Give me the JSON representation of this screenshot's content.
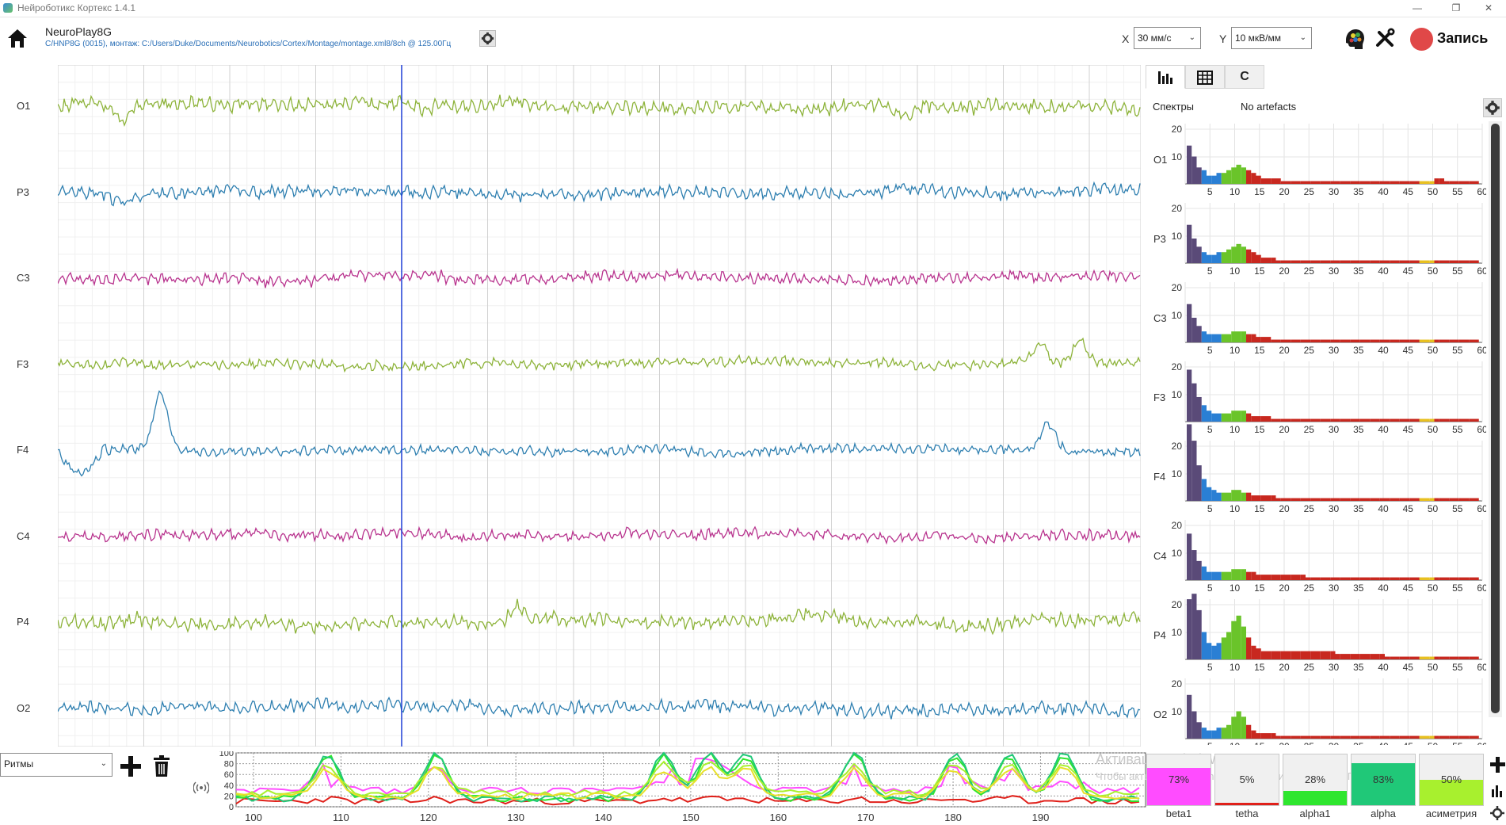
{
  "window": {
    "title": "Нейроботикс Кортекс 1.4.1",
    "minimize": "—",
    "restore": "❐",
    "close": "✕"
  },
  "header": {
    "device_name": "NeuroPlay8G",
    "device_path": "C/HNP8G (0015), монтаж: C:/Users/Duke/Documents/Neurobotics/Cortex/Montage/montage.xml8/8ch @ 125.00Гц",
    "x_label": "X",
    "x_value": "30 мм/с",
    "y_label": "Y",
    "y_value": "10 мкВ/мм",
    "record_label": "Запись"
  },
  "eeg": {
    "channels": [
      {
        "name": "O1",
        "color": "#8db33a",
        "amp": 9,
        "spikes": [
          [
            80,
            22
          ],
          [
            1070,
            14
          ]
        ]
      },
      {
        "name": "P3",
        "color": "#2e7fb0",
        "amp": 8,
        "spikes": [
          [
            80,
            10
          ]
        ]
      },
      {
        "name": "C3",
        "color": "#b8338e",
        "amp": 7,
        "spikes": []
      },
      {
        "name": "F3",
        "color": "#8db33a",
        "amp": 6,
        "spikes": [
          [
            1240,
            -26
          ],
          [
            1290,
            -28
          ]
        ]
      },
      {
        "name": "F4",
        "color": "#2e7fb0",
        "amp": 6,
        "spikes": [
          [
            130,
            -70
          ],
          [
            1250,
            -36
          ]
        ]
      },
      {
        "name": "C4",
        "color": "#b8338e",
        "amp": 7,
        "spikes": []
      },
      {
        "name": "P4",
        "color": "#8db33a",
        "amp": 9,
        "spikes": [
          [
            580,
            -18
          ]
        ]
      },
      {
        "name": "O2",
        "color": "#2e7fb0",
        "amp": 8,
        "spikes": []
      }
    ],
    "cursor_color": "#1f3fd6"
  },
  "tabs": [
    {
      "id": "spectra",
      "icon": "bar-chart-icon",
      "label": ""
    },
    {
      "id": "table",
      "icon": "grid-icon",
      "label": ""
    },
    {
      "id": "c",
      "icon": "",
      "label": "C"
    }
  ],
  "spectra_panel": {
    "title": "Спектры",
    "artefacts": "No artefacts",
    "y_ticks": [
      "20",
      "10"
    ],
    "x_ticks": [
      "5",
      "10",
      "15",
      "20",
      "25",
      "30",
      "35",
      "40",
      "45",
      "50",
      "55",
      "60"
    ],
    "band_colors": {
      "delta": "#5a4a78",
      "theta": "#2a7fd4",
      "alpha": "#6ac42a",
      "beta": "#c8281f",
      "gamma": "#e8c020"
    },
    "channels": [
      {
        "name": "O1",
        "profile": [
          14,
          10,
          6,
          5,
          3,
          3,
          4,
          4,
          5,
          6,
          7,
          6,
          5,
          4,
          3,
          2,
          2,
          2,
          2,
          1,
          1,
          1,
          1,
          1,
          1,
          1,
          1,
          1,
          1,
          1,
          1,
          1,
          1,
          1,
          1,
          1,
          1,
          1,
          1,
          1,
          1,
          1,
          1,
          1,
          1,
          1,
          1,
          1,
          1,
          1,
          2,
          2,
          1,
          1,
          1,
          1,
          1,
          1,
          1
        ]
      },
      {
        "name": "P3",
        "profile": [
          14,
          9,
          6,
          4,
          3,
          3,
          4,
          4,
          5,
          6,
          7,
          6,
          5,
          4,
          3,
          2,
          2,
          2,
          1,
          1,
          1,
          1,
          1,
          1,
          1,
          1,
          1,
          1,
          1,
          1,
          1,
          1,
          1,
          1,
          1,
          1,
          1,
          1,
          1,
          1,
          1,
          1,
          1,
          1,
          1,
          1,
          1,
          1,
          1,
          1,
          1,
          1,
          1,
          1,
          1,
          1,
          1,
          1,
          1
        ]
      },
      {
        "name": "C3",
        "profile": [
          14,
          9,
          6,
          4,
          3,
          3,
          3,
          3,
          3,
          4,
          4,
          4,
          3,
          3,
          2,
          2,
          2,
          1,
          1,
          1,
          1,
          1,
          1,
          1,
          1,
          1,
          1,
          1,
          1,
          1,
          1,
          1,
          1,
          1,
          1,
          1,
          1,
          1,
          1,
          1,
          1,
          1,
          1,
          1,
          1,
          1,
          1,
          1,
          1,
          1,
          1,
          1,
          1,
          1,
          1,
          1,
          1,
          1,
          1
        ]
      },
      {
        "name": "F3",
        "profile": [
          19,
          14,
          9,
          6,
          4,
          3,
          3,
          3,
          3,
          4,
          4,
          4,
          3,
          2,
          2,
          2,
          2,
          1,
          1,
          1,
          1,
          1,
          1,
          1,
          1,
          1,
          1,
          1,
          1,
          1,
          1,
          1,
          1,
          1,
          1,
          1,
          1,
          1,
          1,
          1,
          1,
          1,
          1,
          1,
          1,
          1,
          1,
          1,
          1,
          1,
          1,
          1,
          1,
          1,
          1,
          1,
          1,
          1,
          1
        ]
      },
      {
        "name": "F4",
        "profile": [
          28,
          22,
          13,
          8,
          5,
          4,
          3,
          3,
          3,
          4,
          4,
          3,
          3,
          2,
          2,
          2,
          2,
          2,
          1,
          1,
          1,
          1,
          1,
          1,
          1,
          1,
          1,
          1,
          1,
          1,
          1,
          1,
          1,
          1,
          1,
          1,
          1,
          1,
          1,
          1,
          1,
          1,
          1,
          1,
          1,
          1,
          1,
          1,
          1,
          1,
          1,
          1,
          1,
          1,
          1,
          1,
          1,
          1,
          1
        ]
      },
      {
        "name": "C4",
        "profile": [
          17,
          11,
          7,
          5,
          3,
          3,
          3,
          3,
          3,
          4,
          4,
          4,
          3,
          3,
          2,
          2,
          2,
          2,
          2,
          2,
          2,
          2,
          2,
          2,
          1,
          1,
          1,
          1,
          1,
          1,
          1,
          1,
          1,
          1,
          1,
          1,
          1,
          1,
          1,
          1,
          1,
          1,
          1,
          1,
          1,
          1,
          1,
          1,
          1,
          1,
          1,
          1,
          1,
          1,
          1,
          1,
          1,
          1,
          1
        ]
      },
      {
        "name": "P4",
        "profile": [
          22,
          24,
          18,
          10,
          6,
          5,
          6,
          8,
          10,
          14,
          16,
          12,
          8,
          5,
          4,
          3,
          3,
          3,
          3,
          3,
          3,
          3,
          3,
          3,
          3,
          3,
          3,
          3,
          3,
          3,
          2,
          2,
          2,
          2,
          2,
          2,
          2,
          2,
          2,
          2,
          1,
          1,
          1,
          1,
          1,
          1,
          1,
          1,
          1,
          1,
          1,
          1,
          1,
          1,
          1,
          1,
          1,
          1,
          1
        ]
      },
      {
        "name": "O2",
        "profile": [
          16,
          10,
          6,
          4,
          3,
          3,
          4,
          4,
          5,
          8,
          10,
          8,
          5,
          3,
          2,
          2,
          2,
          2,
          1,
          1,
          1,
          1,
          1,
          1,
          1,
          1,
          1,
          1,
          1,
          1,
          1,
          1,
          1,
          1,
          1,
          1,
          1,
          1,
          1,
          1,
          1,
          1,
          1,
          1,
          1,
          1,
          1,
          1,
          1,
          1,
          1,
          1,
          1,
          1,
          1,
          1,
          1,
          1,
          1
        ]
      }
    ]
  },
  "rhythms": {
    "select_value": "Ритмы",
    "y_ticks": [
      "100",
      "80",
      "60",
      "40",
      "20",
      "0"
    ],
    "x_ticks": [
      "100",
      "110",
      "120",
      "130",
      "140",
      "150",
      "160",
      "170",
      "180",
      "190"
    ],
    "meters": [
      {
        "name": "beta1",
        "value": "73%",
        "fraction": 0.73,
        "color": "#ff4cff"
      },
      {
        "name": "tetha",
        "value": "5%",
        "fraction": 0.05,
        "color": "#e0201a"
      },
      {
        "name": "alpha1",
        "value": "28%",
        "fraction": 0.28,
        "color": "#2ee62e"
      },
      {
        "name": "alpha",
        "value": "83%",
        "fraction": 0.83,
        "color": "#20c878"
      },
      {
        "name": "асиметрия",
        "value": "50%",
        "fraction": 0.5,
        "color": "#a8f02e"
      }
    ]
  },
  "watermark": {
    "line1": "Активация Windows",
    "line2": "Чтобы активировать Windows, перейдите в раздел «Параметры»."
  }
}
